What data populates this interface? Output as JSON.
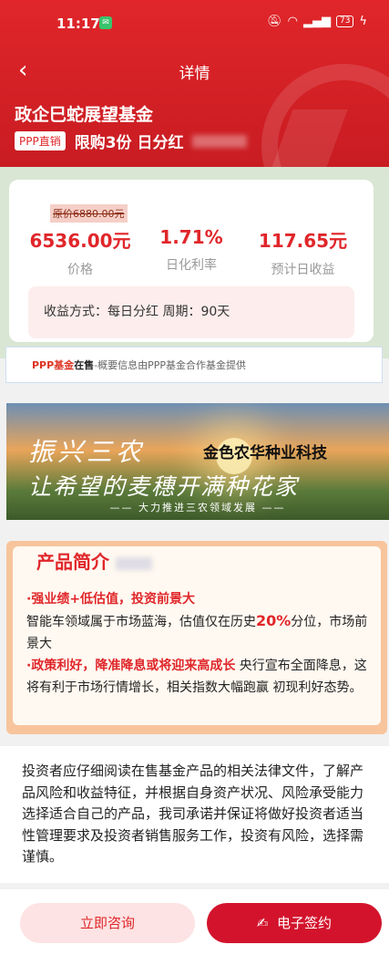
{
  "status_bar": {
    "time": "11:17",
    "battery": "73"
  },
  "nav": {
    "back_glyph": "‹",
    "title": "详情"
  },
  "fund": {
    "name": "政企巳蛇展望基金",
    "tag": "PPP直销",
    "tagline": "限购3份  日分红"
  },
  "price_card": {
    "original_price": "原价6880.00元",
    "stats": [
      {
        "value": "6536.00元",
        "label": "价格"
      },
      {
        "value": "1.71%",
        "label": "日化利率"
      },
      {
        "value": "117.65元",
        "label": "预计日收益"
      }
    ],
    "income_info": "收益方式：每日分红  周期：90天"
  },
  "ppp_strip": {
    "bold": "PPP基金",
    "highlight": "在售",
    "rest": "-概要信息由PPP基金合作基金提供"
  },
  "banner": {
    "line1": "振兴三农",
    "line2": "金色农华种业科技",
    "line3": "让希望的麦穗开满种花家",
    "line4": "—— 大力推进三农领域发展 ——"
  },
  "intro": {
    "title": "产品简介",
    "point1_head": "·强业绩+低估值，投资前景大",
    "point1_body_a": "智能车领域属于市场蓝海，估值仅在历史",
    "point1_pct": "20%",
    "point1_body_b": "分位，市场前景大",
    "point2_head": "·政策利好，降准降息或将迎来高成长",
    "point2_body": "央行宣布全面降息，这将有利于市场行情增长，相关指数大幅跑赢 初现利好态势。"
  },
  "disclaimer": "投资者应仔细阅读在售基金产品的相关法律文件，了解产品风险和收益特征，并根据自身资产状况、风险承受能力选择适合自己的产品，我司承诺并保证将做好投资者适当性管理要求及投资者销售服务工作，投资有风险，选择需谨慎。",
  "footer": {
    "consult_label": "立即咨询",
    "sign_label": "电子签约"
  }
}
